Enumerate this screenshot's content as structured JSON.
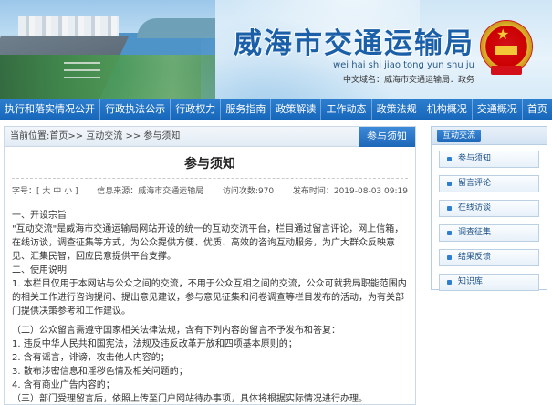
{
  "header": {
    "title": "威海市交通运输局",
    "pinyin": "wei hai shi jiao tong yun shu ju",
    "domain_line": "中文域名：威海市交通运输局．政务"
  },
  "nav": [
    "执行和落实情况公开",
    "行政执法公示",
    "行政权力",
    "服务指南",
    "政策解读",
    "工作动态",
    "政策法规",
    "机构概况",
    "交通概况",
    "首页"
  ],
  "main": {
    "breadcrumb": "当前位置:首页>> 互动交流 >> 参与须知",
    "tab_label": "参与须知",
    "page_title": "参与须知",
    "meta": {
      "font_size": "字号：[ 大 中 小 ]",
      "source": "信息来源：威海市交通运输局",
      "views": "访问次数:970",
      "date": "发布时间：2019-08-03 09:19"
    },
    "paragraphs": [
      "一、开设宗旨",
      "\"互动交流\"是威海市交通运输局网站开设的统一的互动交流平台，栏目通过留言评论，网上信箱，在线访谈，调查征集等方式，为公众提供方便、优质、高效的咨询互动服务，为广大群众反映意见、汇集民智，回应民意提供平台支撑。",
      "二、使用说明",
      "1. 本栏目仅用于本网站与公众之间的交流，不用于公众互相之间的交流，公众可就我局职能范围内的相关工作进行咨询提问、提出意见建议，参与意见征集和问卷调查等栏目发布的活动，为有关部门提供决策参考和工作建议。",
      "",
      "（二）公众留言需遵守国家相关法律法规，含有下列内容的留言不予发布和答复：",
      "1. 违反中华人民共和国宪法，法规及违反改革开放和四项基本原则的；",
      "2. 含有谣言，诽谤，攻击他人内容的；",
      "3. 散布涉密信息和淫秽色情及相关问题的；",
      "4. 含有商业广告内容的；",
      "（三）部门受理留言后，依照上传至门户网站待办事项，具体将根据实际情况进行办理。"
    ]
  },
  "sidebar": {
    "title": "互动交流",
    "items": [
      "参与须知",
      "留言评论",
      "在线访谈",
      "调查征集",
      "结果反馈",
      "知识库"
    ]
  },
  "colors": {
    "brand_blue": "#1a5fa8",
    "nav_blue": "#1565b9",
    "emblem_red": "#d3101a"
  }
}
